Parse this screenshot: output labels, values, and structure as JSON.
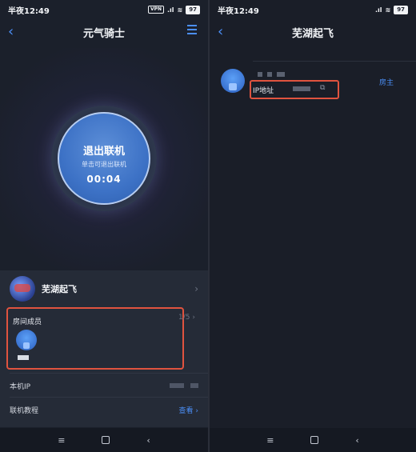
{
  "left": {
    "status": {
      "time": "半夜12:49",
      "vpn": "VPN",
      "signal": ".ıl",
      "wifi": "≋",
      "battery": "97"
    },
    "header": {
      "title": "元气骑士",
      "back": "‹"
    },
    "connect": {
      "title": "退出联机",
      "subtitle": "单击可退出联机",
      "timer": "00:04"
    },
    "room": {
      "name": "芜湖起飞",
      "chevron": "›"
    },
    "members": {
      "label": "房间成员",
      "count": "1/5 ›"
    },
    "ip": {
      "label": "本机IP"
    },
    "guide": {
      "label": "联机教程",
      "link": "查看 ›"
    },
    "navbar": {
      "menu": "≡",
      "back": "‹"
    }
  },
  "right": {
    "status": {
      "time": "半夜12:49",
      "signal": ".ıl",
      "wifi": "≋",
      "battery": "97"
    },
    "header": {
      "title": "芜湖起飞",
      "back": "‹"
    },
    "member": {
      "ip_label": "IP地址",
      "copy": "⧉",
      "role": "房主"
    },
    "navbar": {
      "menu": "≡",
      "back": "‹"
    }
  },
  "colors": {
    "accent": "#4b8ff7",
    "highlight": "#e0533f",
    "background": "#1b202b",
    "card": "#252b37"
  }
}
